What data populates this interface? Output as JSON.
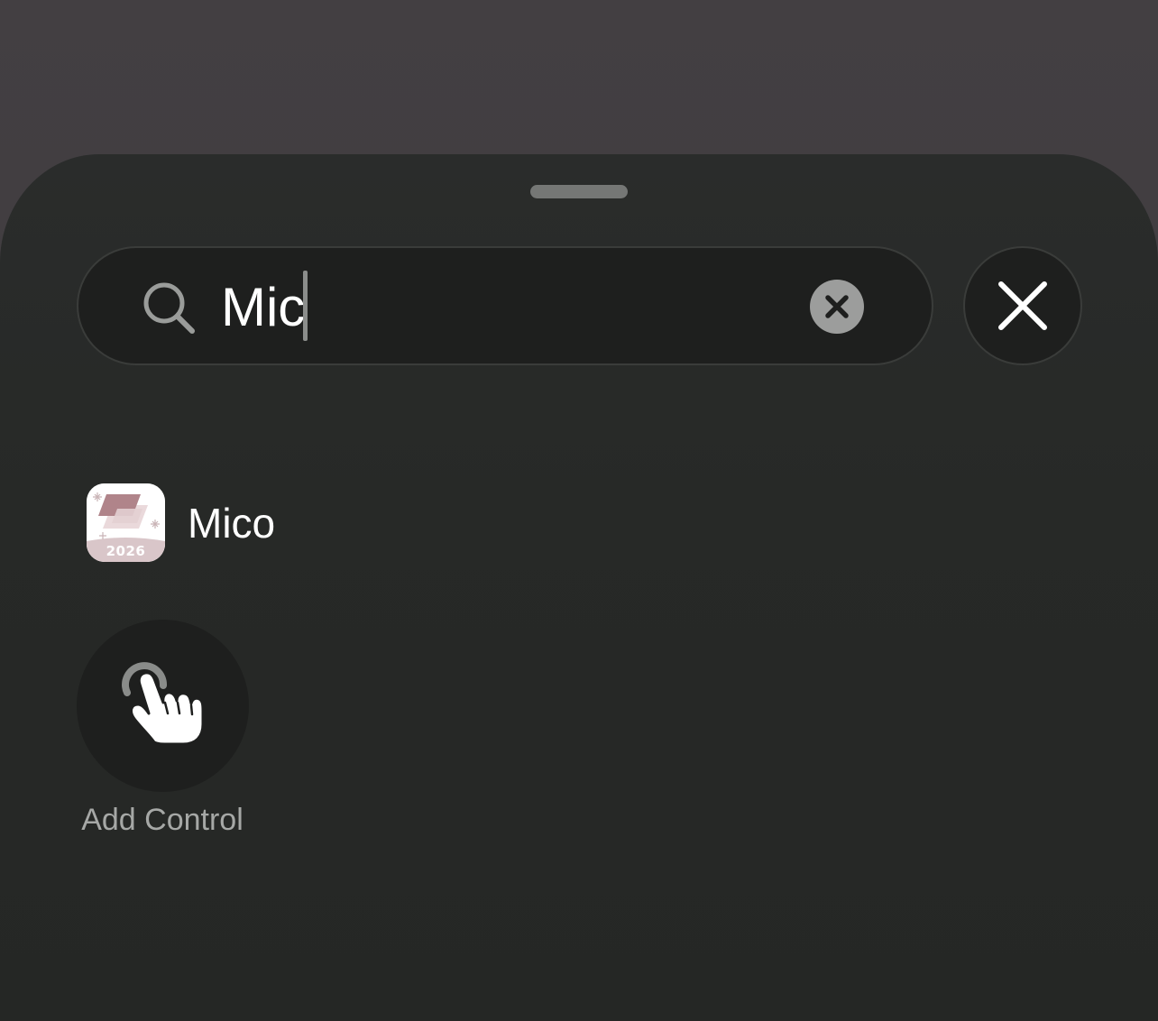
{
  "search": {
    "query": "Mic",
    "search_icon": "magnifying-glass-icon",
    "clear_icon": "clear-circle-x-icon"
  },
  "close_button": {
    "icon": "close-x-icon"
  },
  "results": [
    {
      "app_name": "Mico",
      "icon_badge_text": "2026"
    }
  ],
  "add_control": {
    "label": "Add Control",
    "icon": "hand-tap-icon"
  },
  "colors": {
    "backdrop": "#433f42",
    "sheet": "#272927",
    "field": "#1e1f1e",
    "text_primary": "#ffffff",
    "text_secondary": "#a6a8a6"
  }
}
